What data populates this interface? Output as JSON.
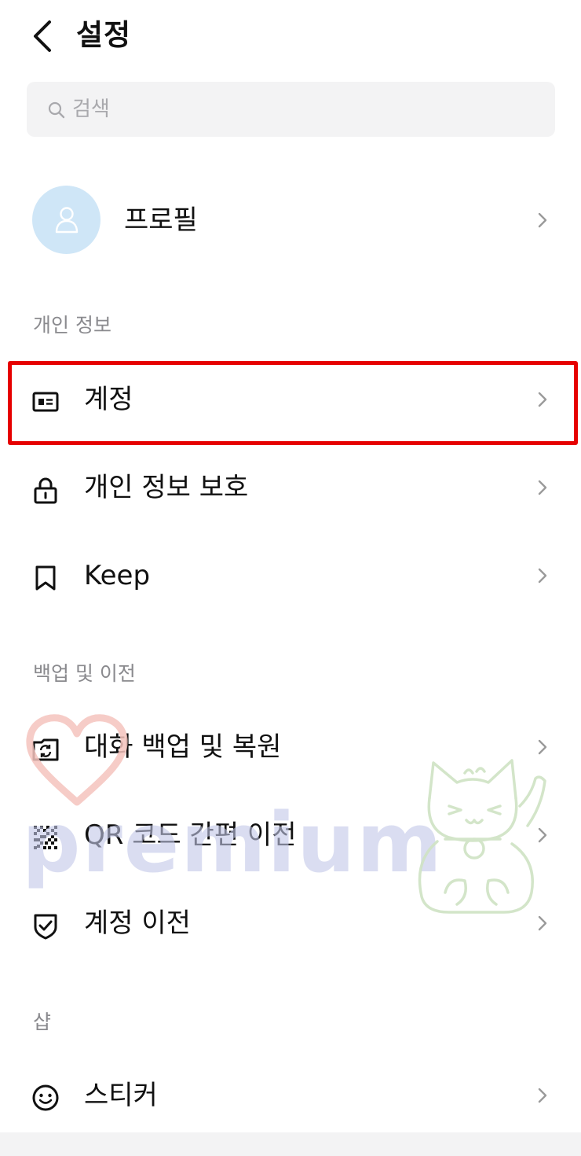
{
  "header": {
    "title": "설정",
    "back_icon": "chevron-left-icon"
  },
  "search": {
    "placeholder": "검색",
    "icon": "search-icon"
  },
  "profile": {
    "label": "프로필",
    "icon": "person-icon"
  },
  "sections": {
    "personal": {
      "title": "개인 정보",
      "items": [
        {
          "label": "계정",
          "icon": "id-card-icon",
          "highlighted": true
        },
        {
          "label": "개인 정보 보호",
          "icon": "lock-icon"
        },
        {
          "label": "Keep",
          "icon": "bookmark-icon"
        }
      ]
    },
    "backup": {
      "title": "백업 및 이전",
      "items": [
        {
          "label": "대화 백업 및 복원",
          "icon": "backup-restore-icon"
        },
        {
          "label": "QR 코드 간편 이전",
          "icon": "qr-code-icon"
        },
        {
          "label": "계정 이전",
          "icon": "shield-check-icon"
        }
      ]
    },
    "shop": {
      "title": "샵",
      "items": [
        {
          "label": "스티커",
          "icon": "smiley-icon"
        }
      ]
    }
  },
  "watermark": {
    "text": "premium"
  },
  "colors": {
    "highlight": "#e60000",
    "avatar_bg": "#cfe6f7",
    "search_bg": "#f3f3f4",
    "section_label": "#8a8a8e",
    "chevron": "#9a9a9a",
    "watermark_text": "#c3c8e8",
    "watermark_heart": "#f5c3bd",
    "watermark_cat": "#cfe3c4"
  }
}
